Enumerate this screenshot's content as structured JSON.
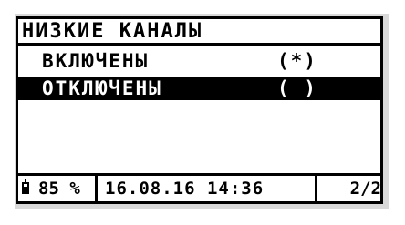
{
  "screen": {
    "title": "НИЗКИЕ КАНАЛЫ",
    "items": [
      {
        "label": "ВКЛЮЧЕНЫ",
        "mark": "(*)",
        "selected": false
      },
      {
        "label": "ОТКЛЮЧЕНЫ",
        "mark": "( )",
        "selected": true
      }
    ],
    "status": {
      "battery_icon": "battery-icon",
      "battery_text": "85 %",
      "datetime": "16.08.16 14:36",
      "page": "2/2"
    },
    "colors": {
      "background": "#ffffff",
      "foreground": "#000000",
      "highlight_background": "#000000",
      "highlight_foreground": "#ffffff"
    }
  }
}
